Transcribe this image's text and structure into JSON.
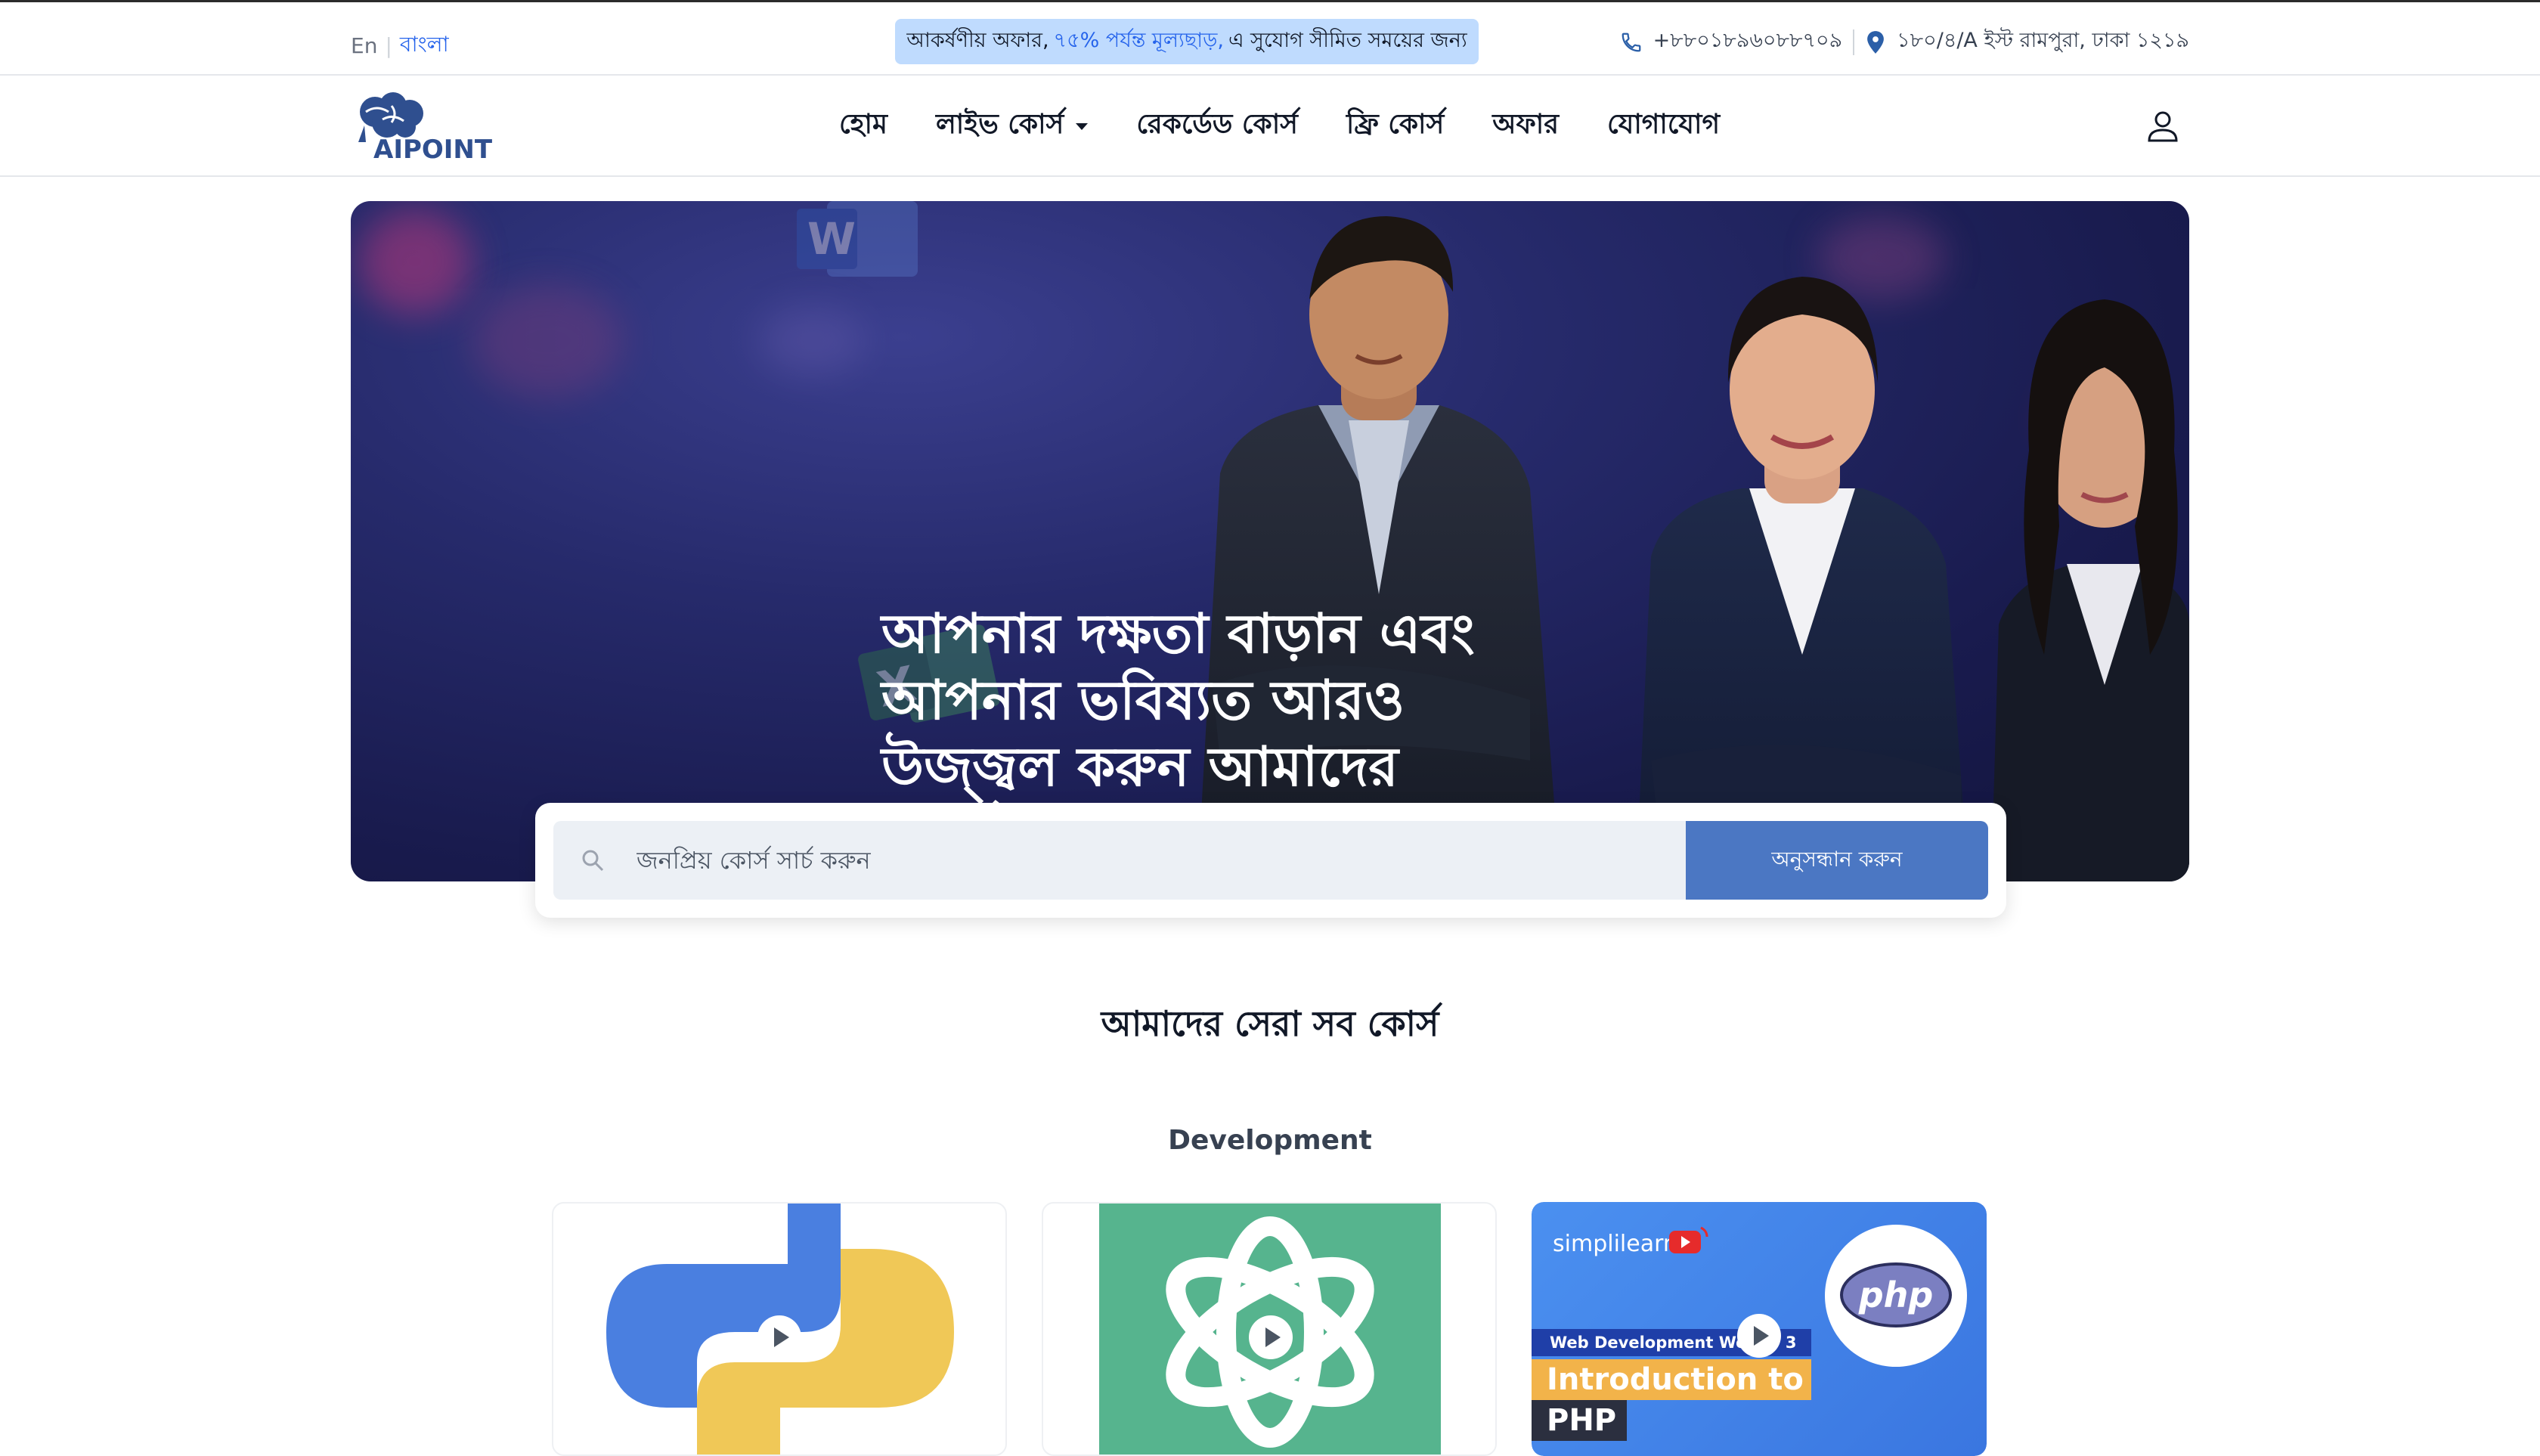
{
  "topbar": {
    "lang_en": "En",
    "lang_bn": "বাংলা",
    "promo_prefix": "আকর্ষণীয় অফার,",
    "promo_highlight": "৭৫% পর্যন্ত মূল্যছাড়,",
    "promo_suffix": "এ সুযোগ সীমিত সময়ের জন্য",
    "phone": "+৮৮০১৮৯৬০৮৮৭০৯",
    "address": "১৮০/৪/A ইস্ট রামপুরা, ঢাকা ১২১৯"
  },
  "brand": {
    "logo_text": "AIPOINT",
    "color": "#2f4f8f"
  },
  "nav": {
    "items": [
      {
        "label": "হোম"
      },
      {
        "label": "লাইভ কোর্স",
        "has_dropdown": true
      },
      {
        "label": "রেকর্ডেড কোর্স"
      },
      {
        "label": "ফ্রি কোর্স"
      },
      {
        "label": "অফার"
      },
      {
        "label": "যোগাযোগ"
      }
    ],
    "user_icon": "user-icon"
  },
  "hero": {
    "title": "আপনার দক্ষতা বাড়ান এবং আপনার ভবিষ্যত আরও উজ্জ্বল করুন আমাদের কোর্সগুলোর সাথে।"
  },
  "search": {
    "placeholder": "জনপ্রিয় কোর্স সার্চ করুন",
    "button_label": "অনুসন্ধান করুন",
    "icon": "search-icon"
  },
  "courses": {
    "title": "আমাদের সেরা সব কোর্স",
    "category": "Development",
    "cards": [
      {
        "name": "python-course",
        "thumbnail": "python-logo"
      },
      {
        "name": "chatgpt-course",
        "thumbnail": "openai-logo"
      },
      {
        "name": "php-course",
        "thumbnail": "php-thumbnail",
        "brand": "simplilearn",
        "tag": "Web Development Week - 3",
        "line1": "Introduction to",
        "line2": "PHP",
        "badge": "php"
      }
    ]
  },
  "colors": {
    "accent": "#4b77c3",
    "promo_bg": "#bfdbfe",
    "link": "#2563eb"
  }
}
